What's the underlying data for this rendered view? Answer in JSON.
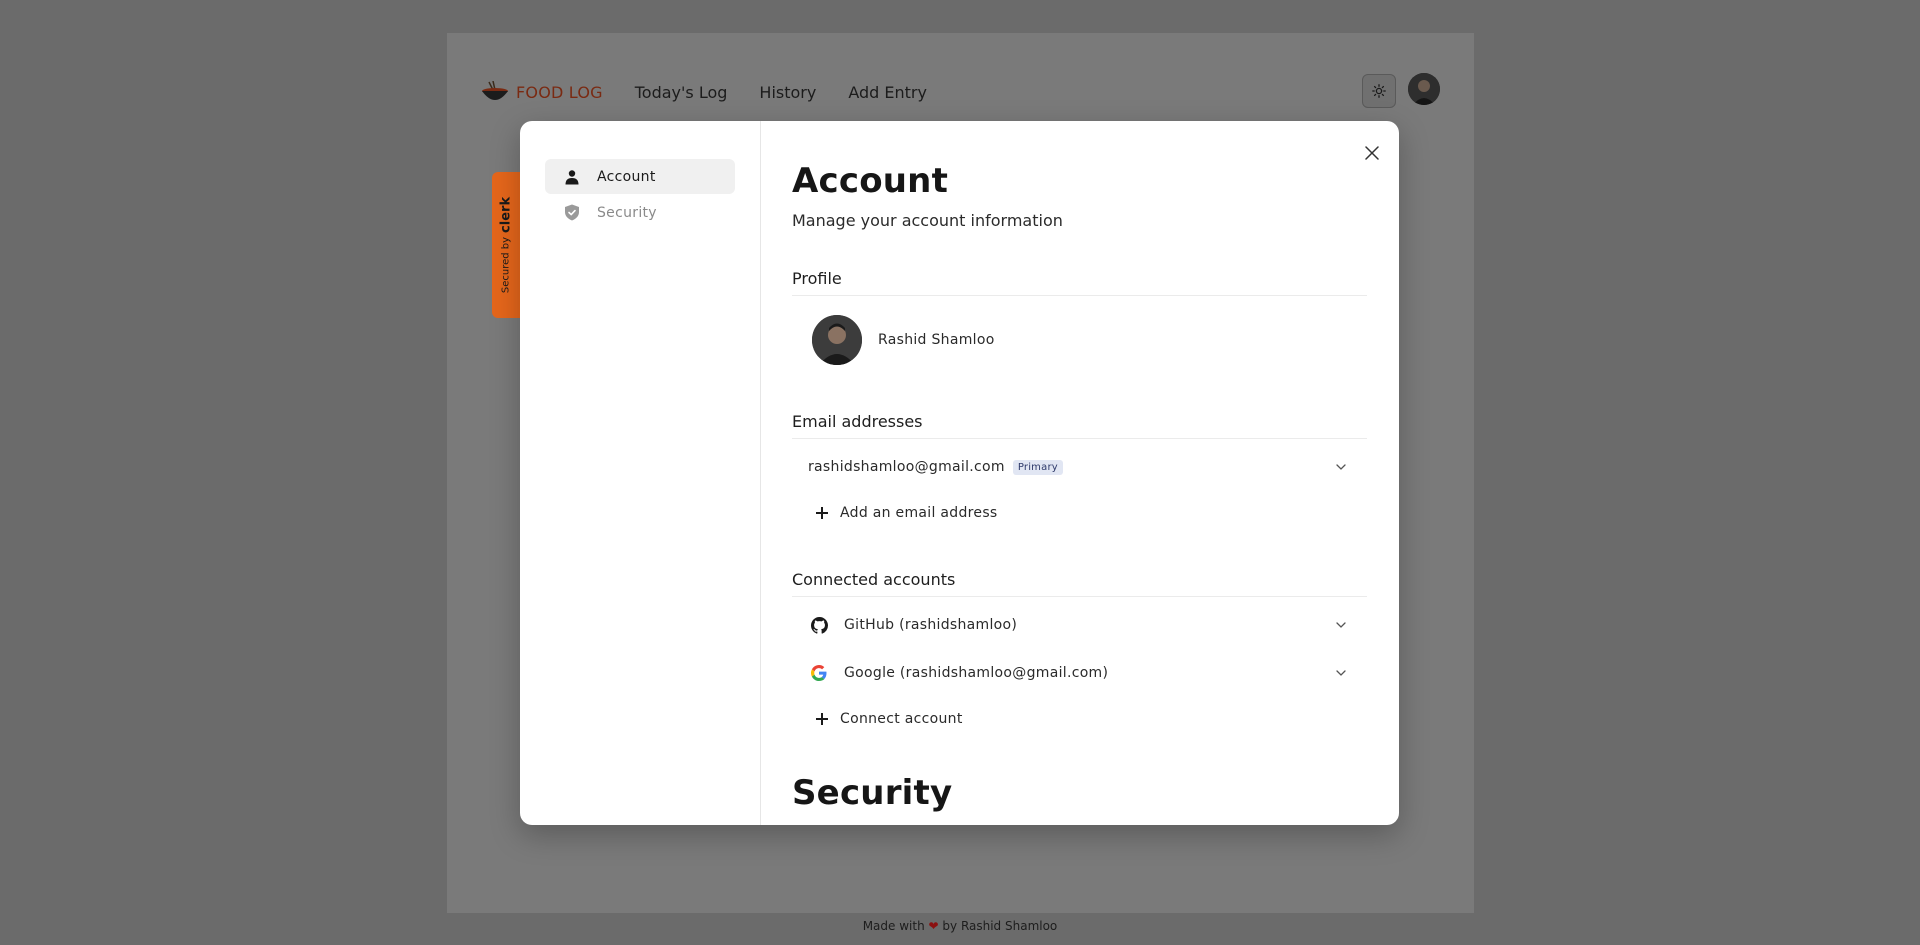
{
  "app": {
    "logo_text": "FOOD LOG",
    "nav": [
      "Today's Log",
      "History",
      "Add Entry"
    ]
  },
  "footer": {
    "before": "Made with",
    "after": "by Rashid Shamloo"
  },
  "clerk_badge": {
    "secured_by": "Secured by",
    "brand": "clerk"
  },
  "sidebar": {
    "items": [
      {
        "label": "Account",
        "icon": "user-icon",
        "active": true
      },
      {
        "label": "Security",
        "icon": "shield-icon",
        "active": false
      }
    ]
  },
  "account": {
    "title": "Account",
    "subtitle": "Manage your account information",
    "profile_heading": "Profile",
    "profile_name": "Rashid Shamloo",
    "email_heading": "Email addresses",
    "emails": [
      {
        "address": "rashidshamloo@gmail.com",
        "badge": "Primary"
      }
    ],
    "add_email_label": "Add an email address",
    "connected_heading": "Connected accounts",
    "connected": [
      {
        "label": "GitHub (rashidshamloo)",
        "icon": "github-icon"
      },
      {
        "label": "Google (rashidshamloo@gmail.com)",
        "icon": "google-icon"
      }
    ],
    "connect_label": "Connect account",
    "security_title": "Security"
  },
  "colors": {
    "accent": "#e5661b",
    "overlay": "#6b6b6b",
    "modal_bg": "#ffffff"
  }
}
